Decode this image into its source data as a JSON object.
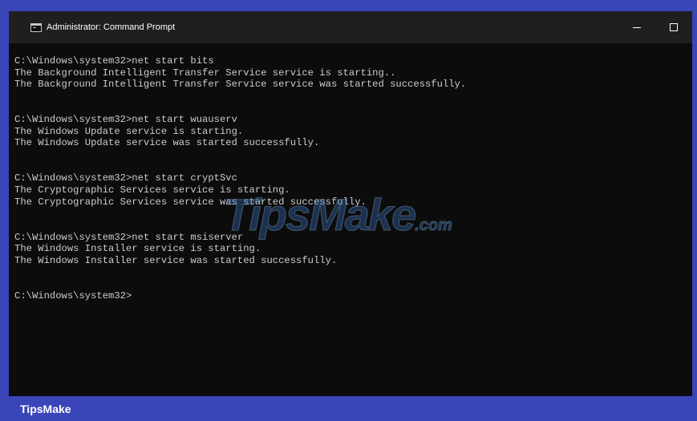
{
  "window": {
    "title": "Administrator: Command Prompt"
  },
  "console": {
    "lines": [
      "C:\\Windows\\system32>net start bits",
      "The Background Intelligent Transfer Service service is starting..",
      "The Background Intelligent Transfer Service service was started successfully.",
      "",
      "",
      "C:\\Windows\\system32>net start wuauserv",
      "The Windows Update service is starting.",
      "The Windows Update service was started successfully.",
      "",
      "",
      "C:\\Windows\\system32>net start cryptSvc",
      "The Cryptographic Services service is starting.",
      "The Cryptographic Services service was started successfully.",
      "",
      "",
      "C:\\Windows\\system32>net start msiserver",
      "The Windows Installer service is starting.",
      "The Windows Installer service was started successfully.",
      "",
      "",
      "C:\\Windows\\system32>"
    ]
  },
  "watermark": {
    "text": "TipsMake",
    "suffix": ".com"
  },
  "footer": {
    "brand": "TipsMake"
  },
  "colors": {
    "frame": "#3a45b8",
    "console_bg": "#0c0c0c",
    "titlebar_bg": "#1f1f1f",
    "console_text": "#cccccc"
  },
  "icons": {
    "app": "cmd-icon",
    "minimize": "minimize-icon",
    "maximize": "maximize-icon"
  }
}
